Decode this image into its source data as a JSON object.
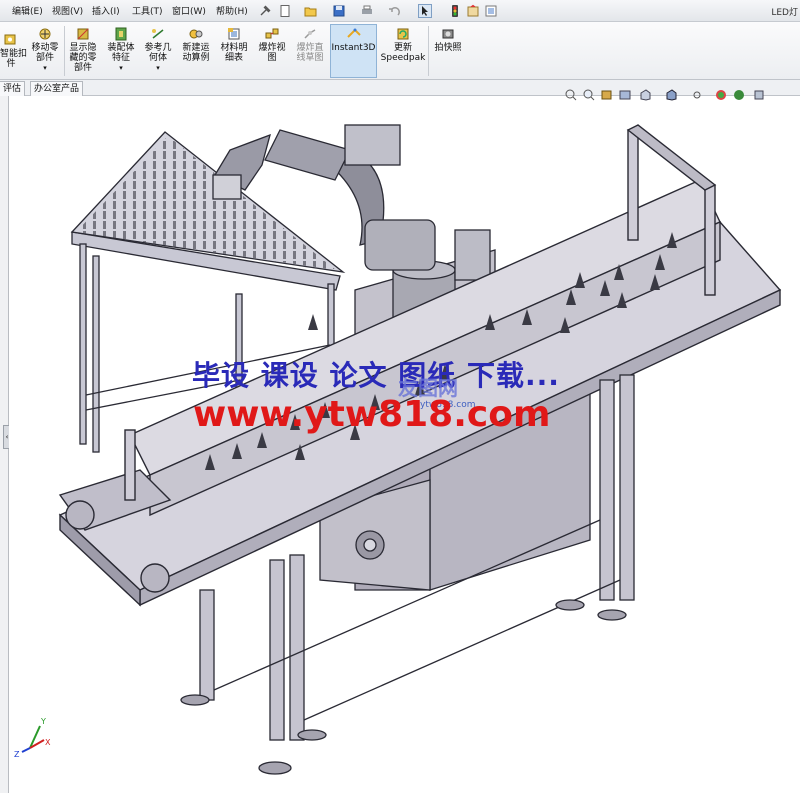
{
  "menu": {
    "items": [
      "编辑(E)",
      "视图(V)",
      "插入(I)",
      "工具(T)",
      "窗口(W)",
      "帮助(H)"
    ],
    "window_title": "LED灯"
  },
  "commands": [
    {
      "label": "智能扣\n件"
    },
    {
      "label": "移动零\n部件"
    },
    {
      "label": "显示隐\n藏的零\n部件"
    },
    {
      "label": "装配体\n特征"
    },
    {
      "label": "参考几\n何体"
    },
    {
      "label": "新建运\n动算例"
    },
    {
      "label": "材料明\n细表"
    },
    {
      "label": "爆炸视\n图"
    },
    {
      "label": "爆炸直\n线草图"
    },
    {
      "label": "Instant3D"
    },
    {
      "label": "更新\nSpeedpak"
    },
    {
      "label": "拍快照"
    }
  ],
  "tabs": [
    "评估",
    "办公室产品"
  ],
  "watermark": {
    "line1": "毕设 课设 论文 图纸 下载...",
    "line2": "www.ytw818.com",
    "logo_text": "友图网",
    "logo_sub": "ytw818.com"
  },
  "colors": {
    "frame": "#c8c8d4",
    "frame_edge": "#2a2a34",
    "cabinet": "#b8b6c2",
    "robot": "#a8a8b2",
    "wm_blue": "#2a2ab8",
    "wm_red": "#e01818"
  },
  "triad": {
    "x": "X",
    "y": "Y",
    "z": "Z"
  }
}
